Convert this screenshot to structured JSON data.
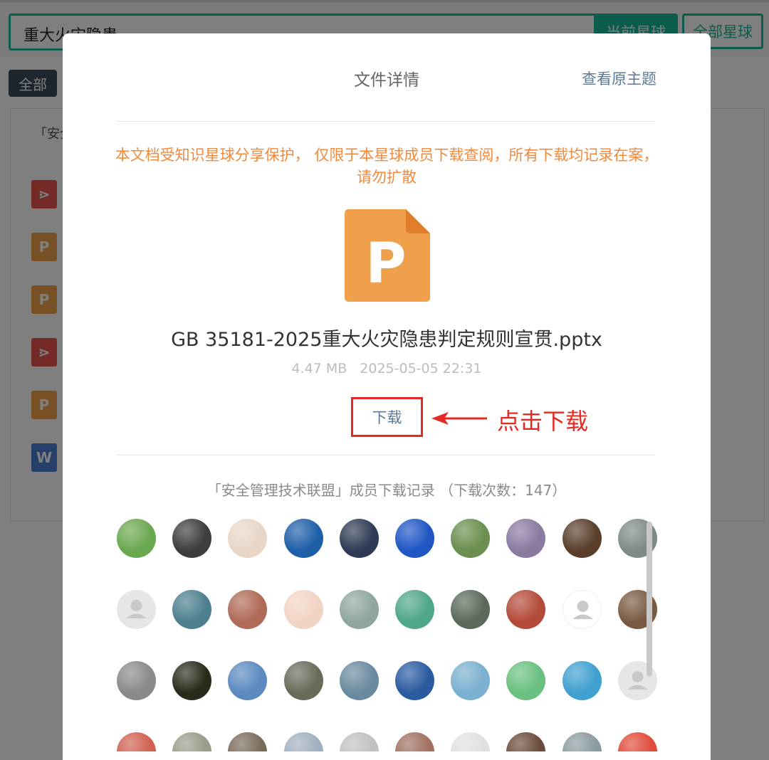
{
  "search": {
    "value": "重大火灾隐患",
    "btn_current": "当前星球",
    "btn_all": "全部星球"
  },
  "filter": {
    "all_tag": "全部"
  },
  "background_list": {
    "first_row_title": "「安全",
    "file_types": [
      "pdf",
      "ppt",
      "ppt",
      "pdf",
      "ppt",
      "doc"
    ]
  },
  "modal": {
    "title": "文件详情",
    "view_origin": "查看原主题",
    "notice": "本文档受知识星球分享保护， 仅限于本星球成员下载查阅，所有下载均记录在案，请勿扩散",
    "file_icon_letter": "P",
    "file_name": "GB 35181-2025重大火灾隐患判定规则宣贯.pptx",
    "file_size": "4.47 MB",
    "file_time": "2025-05-05 22:31",
    "download_label": "下载",
    "annotation": "点击下载",
    "records_title": "「安全管理技术联盟」成员下载记录 （下载次数：147）"
  },
  "colors": {
    "accent_green": "#16b998",
    "notice_orange": "#f08a3e",
    "annotation_red": "#e42a22",
    "link_blue": "#5a7a95",
    "ppt_orange": "#f0a04b"
  },
  "avatar_rows": [
    [
      "#6aa84f",
      "#3d3d3d",
      "#e8d6c8",
      "#1e5fa8",
      "#2e3b55",
      "#1f56c4",
      "#6a8f4e",
      "#8a7aa0",
      "#5a3e2a",
      "#7f8a86"
    ],
    [
      "#e6e6e6",
      "#4d7f8f",
      "#b06a58",
      "#f2d4c4",
      "#8fa6a0",
      "#4fa68a",
      "#5a6a5a",
      "#b44a3a",
      "#ffffff",
      "#7a5a42"
    ],
    [
      "#8a8a8a",
      "#2a2a1a",
      "#5a8ac0",
      "#6a6a5a",
      "#6a8aa0",
      "#2a5aa0",
      "#7ab0d0",
      "#6ac080",
      "#40a0d0",
      "#e6e6e6"
    ],
    [
      "#d06050",
      "#9a9a8a",
      "#7a6a5a",
      "#a0b0c0",
      "#c0c0c0",
      "#a07060",
      "#e0e0e0",
      "#6a4a3a",
      "#8a9aa0",
      "#e04a3a"
    ]
  ]
}
